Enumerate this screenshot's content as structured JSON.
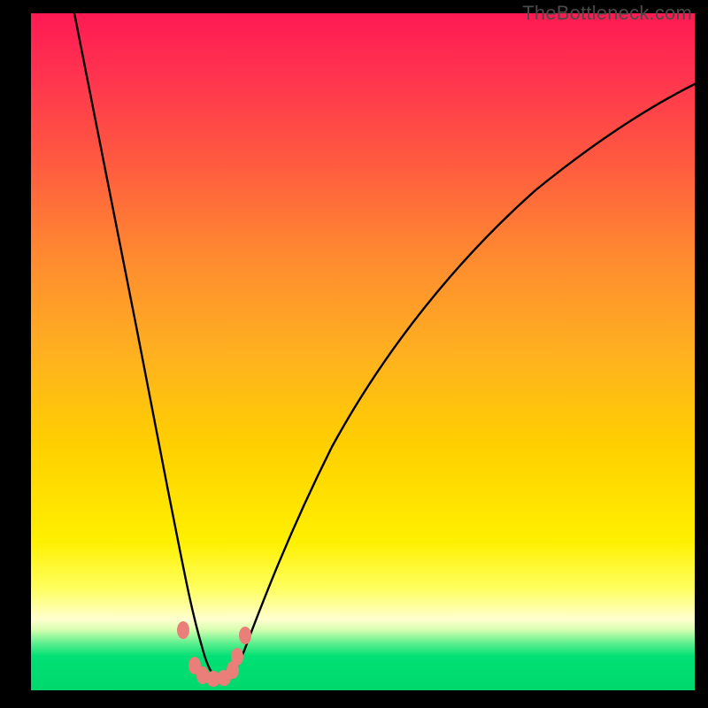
{
  "watermark": "TheBottleneck.com",
  "chart_data": {
    "type": "line",
    "title": "",
    "xlabel": "",
    "ylabel": "",
    "xlim": [
      0,
      100
    ],
    "ylim": [
      0,
      100
    ],
    "note": "Axis values estimated from pixel positions; no numeric tick labels are rendered. y=0 is the bottom green band (best), y=100 is the top red band (worst). The curve minimum is near x≈27.",
    "series": [
      {
        "name": "bottleneck-curve",
        "x": [
          6.5,
          10,
          14,
          18,
          22,
          24,
          25.5,
          27,
          29,
          31,
          34,
          40,
          48,
          58,
          70,
          84,
          100
        ],
        "y": [
          100,
          78,
          55,
          34,
          14,
          6,
          2.2,
          1.5,
          2.2,
          5,
          12,
          26,
          41,
          55,
          67,
          77,
          84
        ]
      }
    ],
    "markers": [
      {
        "x": 22.5,
        "y": 8.5
      },
      {
        "x": 24.3,
        "y": 3.2
      },
      {
        "x": 25.5,
        "y": 2.0
      },
      {
        "x": 27.0,
        "y": 1.6
      },
      {
        "x": 28.6,
        "y": 1.7
      },
      {
        "x": 30.0,
        "y": 3.0
      },
      {
        "x": 30.7,
        "y": 5.0
      },
      {
        "x": 31.9,
        "y": 8.0
      }
    ],
    "colors": {
      "curve": "#000000",
      "markers": "#e97f78",
      "gradient_top": "#ff1a52",
      "gradient_bottom": "#00d86c"
    }
  }
}
